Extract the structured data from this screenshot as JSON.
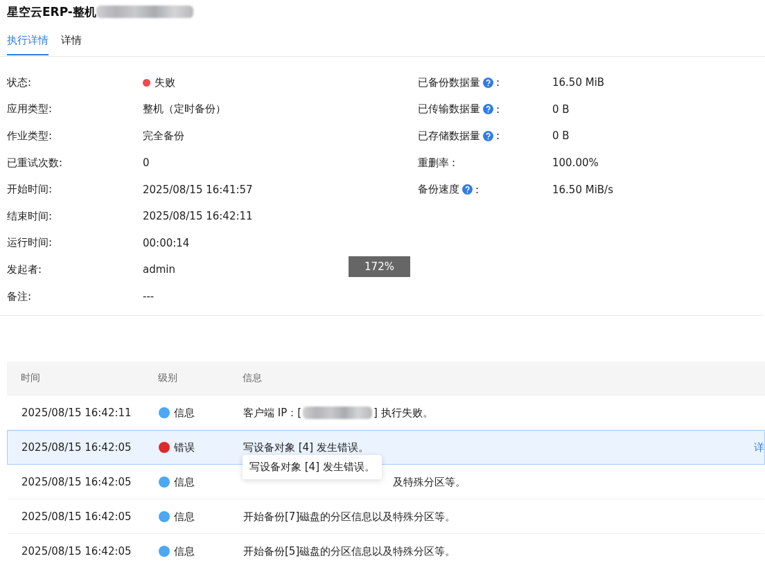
{
  "title": "星空云ERP-整机",
  "tabs": [
    {
      "label": "执行详情",
      "selected": true
    },
    {
      "label": "详情",
      "selected": false
    }
  ],
  "details_left": [
    {
      "label": "状态:",
      "value": "失败",
      "color": "#f5474f"
    },
    {
      "label": "应用类型:",
      "value": "整机（定时备份）"
    },
    {
      "label": "作业类型:",
      "value": "完全备份"
    },
    {
      "label": "已重试次数:",
      "value": "0"
    },
    {
      "label": "开始时间:",
      "value": "2025/08/15 16:41:57"
    },
    {
      "label": "结束时间:",
      "value": "2025/08/15 16:42:11"
    },
    {
      "label": "运行时间:",
      "value": "00:00:14"
    },
    {
      "label": "发起者:",
      "value": "admin"
    },
    {
      "label": "备注:",
      "value": "---"
    }
  ],
  "details_right": [
    {
      "label": "已备份数据量",
      "help": true,
      "colon": ":",
      "value": "16.50 MiB"
    },
    {
      "label": "已传输数据量",
      "help": true,
      "colon": ":",
      "value": "0 B"
    },
    {
      "label": "已存储数据量",
      "help": true,
      "colon": ":",
      "value": "0 B"
    },
    {
      "label": "重删率",
      "help": false,
      "colon": ":",
      "value": "100.00%"
    },
    {
      "label": "备份速度",
      "help": true,
      "colon": ":",
      "value": "16.50 MiB/s"
    }
  ],
  "zoom_indicator": "172%",
  "log_table": {
    "columns": [
      "时间",
      "级别",
      "信息"
    ],
    "rows": [
      {
        "time": "2025/08/15 16:42:11",
        "level": "信息",
        "color": "#4aa8f5",
        "selected": false,
        "message": "客户端 IP：[",
        "message_end": "] 执行失败。"
      },
      {
        "time": "2025/08/15 16:42:05",
        "level": "错误",
        "color": "#dc2b2b",
        "selected": true,
        "message": "写设备对象 [4] 发生错误。",
        "action": "详"
      },
      {
        "time": "2025/08/15 16:42:05",
        "level": "信息",
        "color": "#4aa8f5",
        "selected": false,
        "message": "及特殊分区等。",
        "covered": true
      },
      {
        "time": "2025/08/15 16:42:05",
        "level": "信息",
        "color": "#4aa8f5",
        "selected": false,
        "message": "开始备份[7]磁盘的分区信息以及特殊分区等。"
      },
      {
        "time": "2025/08/15 16:42:05",
        "level": "信息",
        "color": "#4aa8f5",
        "selected": false,
        "message": "开始备份[5]磁盘的分区信息以及特殊分区等。"
      }
    ],
    "tooltip": "写设备对象 [4] 发生错误。"
  }
}
